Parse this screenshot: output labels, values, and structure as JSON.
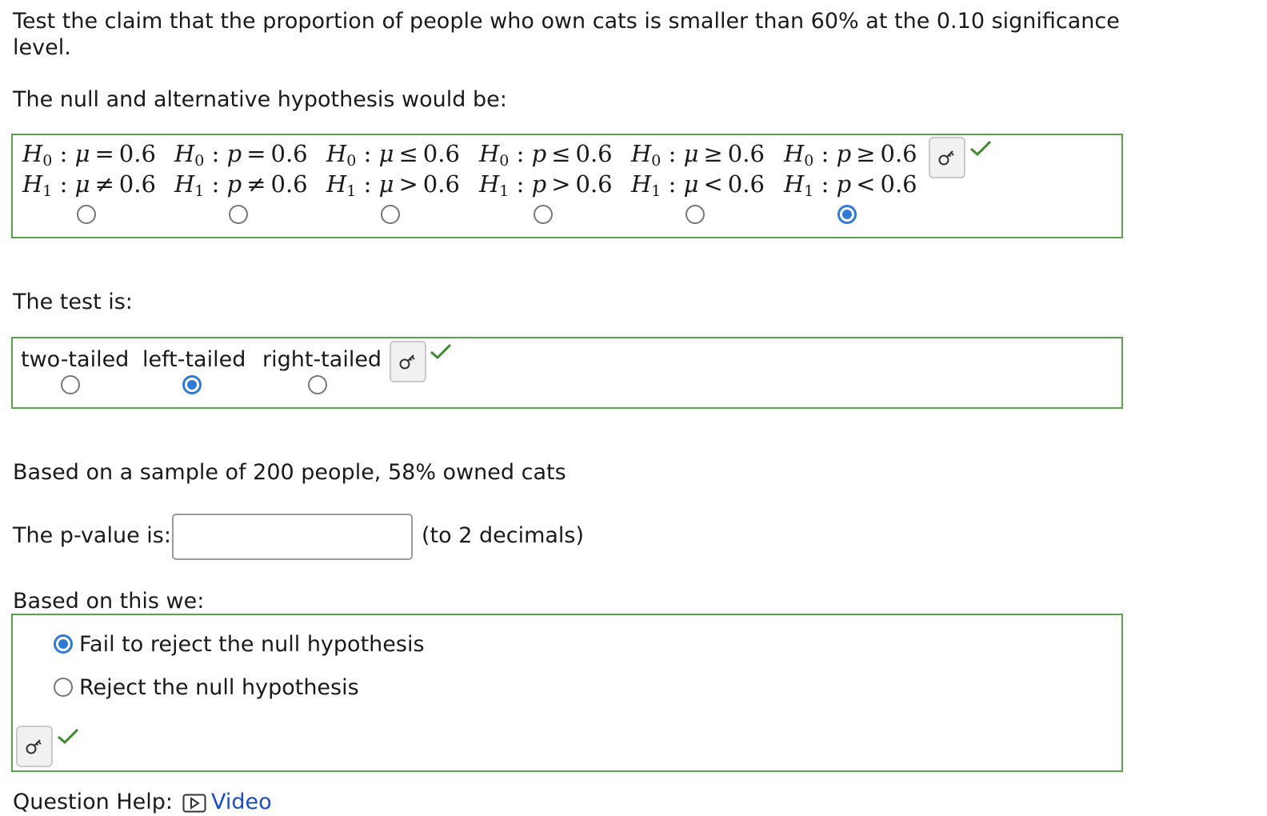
{
  "question": {
    "line1": "Test the claim that the proportion of people who own cats is smaller than 60% at the 0.10 significance",
    "line2": "level."
  },
  "hypothesis_section": {
    "label": "The null and alternative hypothesis would be:",
    "selected_index": 5,
    "options": [
      {
        "h0_rel": "=",
        "h1_rel": "≠",
        "param": "μ",
        "value": "0.6"
      },
      {
        "h0_rel": "=",
        "h1_rel": "≠",
        "param": "p",
        "value": "0.6"
      },
      {
        "h0_rel": "≤",
        "h1_rel": ">",
        "param": "μ",
        "value": "0.6"
      },
      {
        "h0_rel": "≤",
        "h1_rel": ">",
        "param": "p",
        "value": "0.6"
      },
      {
        "h0_rel": "≥",
        "h1_rel": "<",
        "param": "μ",
        "value": "0.6"
      },
      {
        "h0_rel": "≥",
        "h1_rel": "<",
        "param": "p",
        "value": "0.6"
      }
    ]
  },
  "test_section": {
    "label": "The test is:",
    "options": [
      "two-tailed",
      "left-tailed",
      "right-tailed"
    ],
    "selected_index": 1
  },
  "sample_text": "Based on a sample of 200 people, 58% owned cats",
  "pvalue": {
    "label": "The p-value is:",
    "value": "",
    "suffix": "(to 2 decimals)"
  },
  "decision_section": {
    "label": "Based on this we:",
    "options": [
      "Fail to reject the null hypothesis",
      "Reject the null hypothesis"
    ],
    "selected_index": 0
  },
  "footer": {
    "help_label": "Question Help:",
    "video_label": "Video"
  },
  "icons": {
    "key": "key-icon",
    "check": "checkmark-icon",
    "video": "video-icon"
  },
  "colors": {
    "border_green": "#5aa34a",
    "check_green": "#3b8a2f",
    "radio_blue": "#2f7bd6",
    "link_blue": "#1a4cc2"
  }
}
